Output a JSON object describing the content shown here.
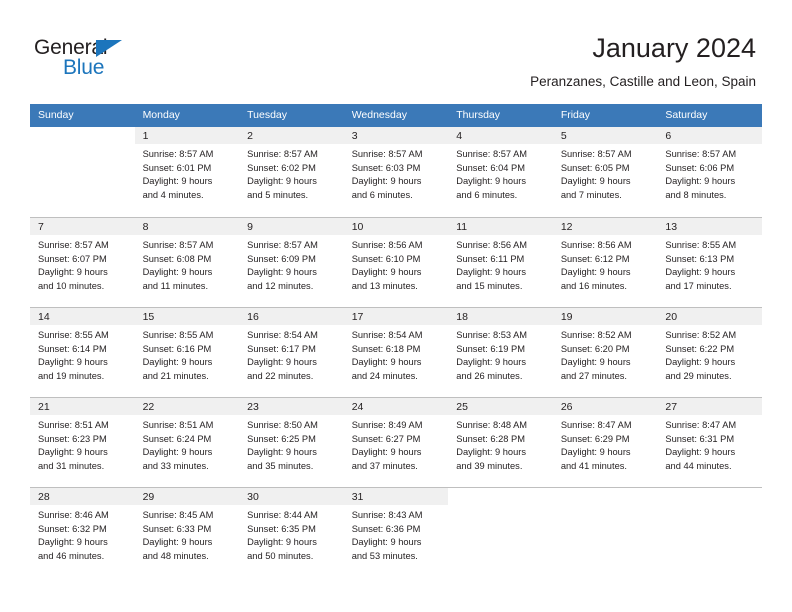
{
  "branding": {
    "name_top": "General",
    "name_bottom": "Blue",
    "accent_color": "#1c75bc",
    "triangle_icon": "triangle-icon"
  },
  "header": {
    "title": "January 2024",
    "subtitle": "Peranzanes, Castille and Leon, Spain"
  },
  "theme": {
    "header_row_color": "#3b79b8",
    "daynum_band_color": "#f0f0f0",
    "grid_line_color": "#bfbfbf",
    "text_color": "#231f20"
  },
  "calendar": {
    "weekdays": [
      "Sunday",
      "Monday",
      "Tuesday",
      "Wednesday",
      "Thursday",
      "Friday",
      "Saturday"
    ],
    "weeks": [
      [
        {
          "day": "",
          "lines": []
        },
        {
          "day": "1",
          "lines": [
            "Sunrise: 8:57 AM",
            "Sunset: 6:01 PM",
            "Daylight: 9 hours",
            "and 4 minutes."
          ]
        },
        {
          "day": "2",
          "lines": [
            "Sunrise: 8:57 AM",
            "Sunset: 6:02 PM",
            "Daylight: 9 hours",
            "and 5 minutes."
          ]
        },
        {
          "day": "3",
          "lines": [
            "Sunrise: 8:57 AM",
            "Sunset: 6:03 PM",
            "Daylight: 9 hours",
            "and 6 minutes."
          ]
        },
        {
          "day": "4",
          "lines": [
            "Sunrise: 8:57 AM",
            "Sunset: 6:04 PM",
            "Daylight: 9 hours",
            "and 6 minutes."
          ]
        },
        {
          "day": "5",
          "lines": [
            "Sunrise: 8:57 AM",
            "Sunset: 6:05 PM",
            "Daylight: 9 hours",
            "and 7 minutes."
          ]
        },
        {
          "day": "6",
          "lines": [
            "Sunrise: 8:57 AM",
            "Sunset: 6:06 PM",
            "Daylight: 9 hours",
            "and 8 minutes."
          ]
        }
      ],
      [
        {
          "day": "7",
          "lines": [
            "Sunrise: 8:57 AM",
            "Sunset: 6:07 PM",
            "Daylight: 9 hours",
            "and 10 minutes."
          ]
        },
        {
          "day": "8",
          "lines": [
            "Sunrise: 8:57 AM",
            "Sunset: 6:08 PM",
            "Daylight: 9 hours",
            "and 11 minutes."
          ]
        },
        {
          "day": "9",
          "lines": [
            "Sunrise: 8:57 AM",
            "Sunset: 6:09 PM",
            "Daylight: 9 hours",
            "and 12 minutes."
          ]
        },
        {
          "day": "10",
          "lines": [
            "Sunrise: 8:56 AM",
            "Sunset: 6:10 PM",
            "Daylight: 9 hours",
            "and 13 minutes."
          ]
        },
        {
          "day": "11",
          "lines": [
            "Sunrise: 8:56 AM",
            "Sunset: 6:11 PM",
            "Daylight: 9 hours",
            "and 15 minutes."
          ]
        },
        {
          "day": "12",
          "lines": [
            "Sunrise: 8:56 AM",
            "Sunset: 6:12 PM",
            "Daylight: 9 hours",
            "and 16 minutes."
          ]
        },
        {
          "day": "13",
          "lines": [
            "Sunrise: 8:55 AM",
            "Sunset: 6:13 PM",
            "Daylight: 9 hours",
            "and 17 minutes."
          ]
        }
      ],
      [
        {
          "day": "14",
          "lines": [
            "Sunrise: 8:55 AM",
            "Sunset: 6:14 PM",
            "Daylight: 9 hours",
            "and 19 minutes."
          ]
        },
        {
          "day": "15",
          "lines": [
            "Sunrise: 8:55 AM",
            "Sunset: 6:16 PM",
            "Daylight: 9 hours",
            "and 21 minutes."
          ]
        },
        {
          "day": "16",
          "lines": [
            "Sunrise: 8:54 AM",
            "Sunset: 6:17 PM",
            "Daylight: 9 hours",
            "and 22 minutes."
          ]
        },
        {
          "day": "17",
          "lines": [
            "Sunrise: 8:54 AM",
            "Sunset: 6:18 PM",
            "Daylight: 9 hours",
            "and 24 minutes."
          ]
        },
        {
          "day": "18",
          "lines": [
            "Sunrise: 8:53 AM",
            "Sunset: 6:19 PM",
            "Daylight: 9 hours",
            "and 26 minutes."
          ]
        },
        {
          "day": "19",
          "lines": [
            "Sunrise: 8:52 AM",
            "Sunset: 6:20 PM",
            "Daylight: 9 hours",
            "and 27 minutes."
          ]
        },
        {
          "day": "20",
          "lines": [
            "Sunrise: 8:52 AM",
            "Sunset: 6:22 PM",
            "Daylight: 9 hours",
            "and 29 minutes."
          ]
        }
      ],
      [
        {
          "day": "21",
          "lines": [
            "Sunrise: 8:51 AM",
            "Sunset: 6:23 PM",
            "Daylight: 9 hours",
            "and 31 minutes."
          ]
        },
        {
          "day": "22",
          "lines": [
            "Sunrise: 8:51 AM",
            "Sunset: 6:24 PM",
            "Daylight: 9 hours",
            "and 33 minutes."
          ]
        },
        {
          "day": "23",
          "lines": [
            "Sunrise: 8:50 AM",
            "Sunset: 6:25 PM",
            "Daylight: 9 hours",
            "and 35 minutes."
          ]
        },
        {
          "day": "24",
          "lines": [
            "Sunrise: 8:49 AM",
            "Sunset: 6:27 PM",
            "Daylight: 9 hours",
            "and 37 minutes."
          ]
        },
        {
          "day": "25",
          "lines": [
            "Sunrise: 8:48 AM",
            "Sunset: 6:28 PM",
            "Daylight: 9 hours",
            "and 39 minutes."
          ]
        },
        {
          "day": "26",
          "lines": [
            "Sunrise: 8:47 AM",
            "Sunset: 6:29 PM",
            "Daylight: 9 hours",
            "and 41 minutes."
          ]
        },
        {
          "day": "27",
          "lines": [
            "Sunrise: 8:47 AM",
            "Sunset: 6:31 PM",
            "Daylight: 9 hours",
            "and 44 minutes."
          ]
        }
      ],
      [
        {
          "day": "28",
          "lines": [
            "Sunrise: 8:46 AM",
            "Sunset: 6:32 PM",
            "Daylight: 9 hours",
            "and 46 minutes."
          ]
        },
        {
          "day": "29",
          "lines": [
            "Sunrise: 8:45 AM",
            "Sunset: 6:33 PM",
            "Daylight: 9 hours",
            "and 48 minutes."
          ]
        },
        {
          "day": "30",
          "lines": [
            "Sunrise: 8:44 AM",
            "Sunset: 6:35 PM",
            "Daylight: 9 hours",
            "and 50 minutes."
          ]
        },
        {
          "day": "31",
          "lines": [
            "Sunrise: 8:43 AM",
            "Sunset: 6:36 PM",
            "Daylight: 9 hours",
            "and 53 minutes."
          ]
        },
        {
          "day": "",
          "lines": []
        },
        {
          "day": "",
          "lines": []
        },
        {
          "day": "",
          "lines": []
        }
      ]
    ]
  }
}
